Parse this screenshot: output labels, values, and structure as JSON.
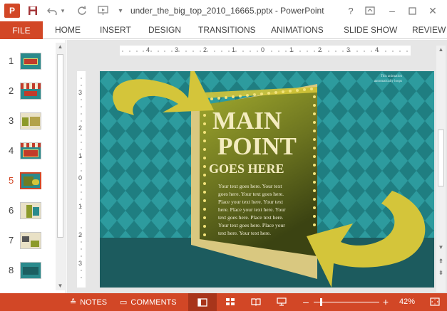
{
  "window": {
    "title": "under_the_big_top_2010_16665.pptx - PowerPoint",
    "app_logo": "P",
    "help_label": "?"
  },
  "ribbon": {
    "file_label": "FILE",
    "tabs": [
      "HOME",
      "INSERT",
      "DESIGN",
      "TRANSITIONS",
      "ANIMATIONS",
      "SLIDE SHOW",
      "REVIEW"
    ]
  },
  "thumbnails": {
    "numbers": [
      "1",
      "2",
      "3",
      "4",
      "5",
      "6",
      "7",
      "8"
    ],
    "active_index": 4
  },
  "ruler": {
    "h_labels": [
      "4",
      "3",
      "2",
      "1",
      "0",
      "1",
      "2",
      "3",
      "4"
    ],
    "v_labels": [
      "3",
      "2",
      "1",
      "0",
      "1",
      "2",
      "3"
    ]
  },
  "slide": {
    "corner_note_line1": "This animation",
    "corner_note_line2": "automatically loops",
    "title_line1": "MAIN",
    "title_line2": "POINT",
    "title_line3": "GOES HERE",
    "body_lines": [
      "Your text goes here. Your text",
      "goes here. Your text goes  here.",
      "Place your text here. Your text",
      "here. Place your text here. Your",
      "text goes here. Place text here.",
      "Your text goes here. Place your",
      "text here. Your text here."
    ]
  },
  "status": {
    "notes_label": "NOTES",
    "comments_label": "COMMENTS",
    "zoom": "42%"
  },
  "colors": {
    "accent": "#d24726",
    "teal": "#1d7d80",
    "olive": "#8c9a2a",
    "arrow": "#d4c53a"
  }
}
